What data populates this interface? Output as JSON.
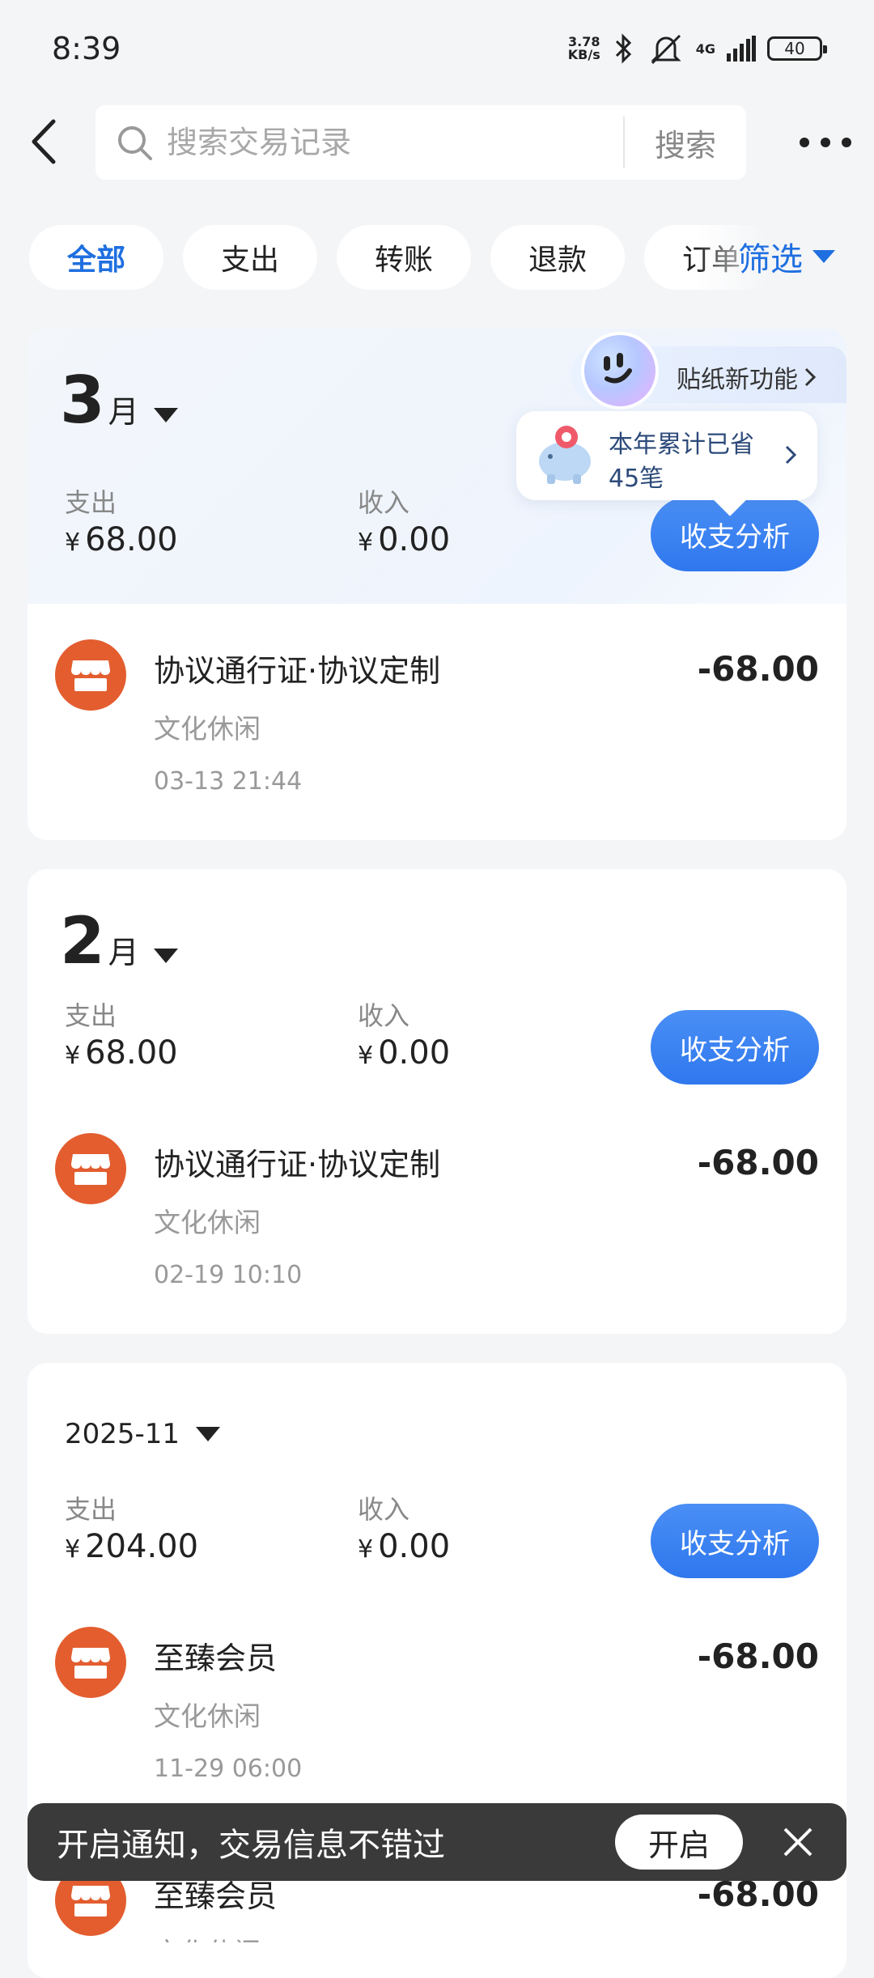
{
  "status_bar": {
    "time": "8:39",
    "net_speed_value": "3.78",
    "net_speed_unit": "KB/s",
    "network": "4G",
    "battery": "40"
  },
  "search": {
    "placeholder": "搜索交易记录",
    "button": "搜索"
  },
  "tabs": [
    {
      "label": "全部",
      "active": true
    },
    {
      "label": "支出"
    },
    {
      "label": "转账"
    },
    {
      "label": "退款"
    },
    {
      "label": "订单"
    }
  ],
  "filter_label": "筛选",
  "sticker": {
    "label": "贴纸新功能"
  },
  "savings": {
    "line1": "本年累计已省",
    "line2": "45笔"
  },
  "months": [
    {
      "number": "3",
      "unit": "月",
      "expense_label": "支出",
      "expense": "68.00",
      "income_label": "收入",
      "income": "0.00",
      "analysis_button": "收支分析",
      "transactions": [
        {
          "title": "协议通行证·协议定制",
          "category": "文化休闲",
          "time": "03-13 21:44",
          "amount": "-68.00"
        }
      ]
    },
    {
      "number": "2",
      "unit": "月",
      "expense_label": "支出",
      "expense": "68.00",
      "income_label": "收入",
      "income": "0.00",
      "analysis_button": "收支分析",
      "transactions": [
        {
          "title": "协议通行证·协议定制",
          "category": "文化休闲",
          "time": "02-19 10:10",
          "amount": "-68.00"
        }
      ]
    },
    {
      "label": "2025-11",
      "expense_label": "支出",
      "expense": "204.00",
      "income_label": "收入",
      "income": "0.00",
      "analysis_button": "收支分析",
      "transactions": [
        {
          "title": "至臻会员",
          "category": "文化休闲",
          "time": "11-29 06:00",
          "amount": "-68.00"
        },
        {
          "title": "至臻会员",
          "category": "文化休闲",
          "amount": "-68.00"
        }
      ]
    }
  ],
  "currency_symbol": "¥",
  "toast": {
    "text": "开启通知，交易信息不错过",
    "button": "开启"
  },
  "colors": {
    "accent": "#2f77ee",
    "store_icon": "#e35d2f",
    "toast_bg": "#3a3a3a"
  }
}
